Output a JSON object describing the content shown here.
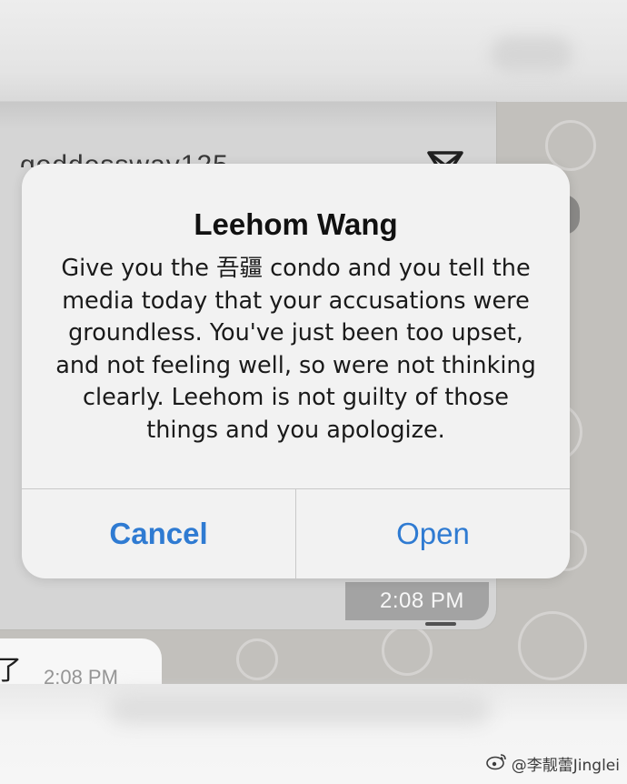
{
  "background_chat": {
    "username_partial": "goddessway125",
    "message_time": "2:08 PM",
    "lower_message_char": "了",
    "lower_message_time": "2:08 PM",
    "send_icon": "send-icon"
  },
  "alert": {
    "title": "Leehom Wang",
    "message": "Give you the 吾疆 condo and you tell the media today that your accusations were groundless. You've just been too upset, and not feeling well, so were not thinking clearly. Leehom is not guilty of those things and you apologize.",
    "cancel_label": "Cancel",
    "open_label": "Open",
    "accent_color": "#2f7bd2"
  },
  "watermark": {
    "text": "@李靓蕾Jinglei",
    "icon": "weibo-icon"
  }
}
